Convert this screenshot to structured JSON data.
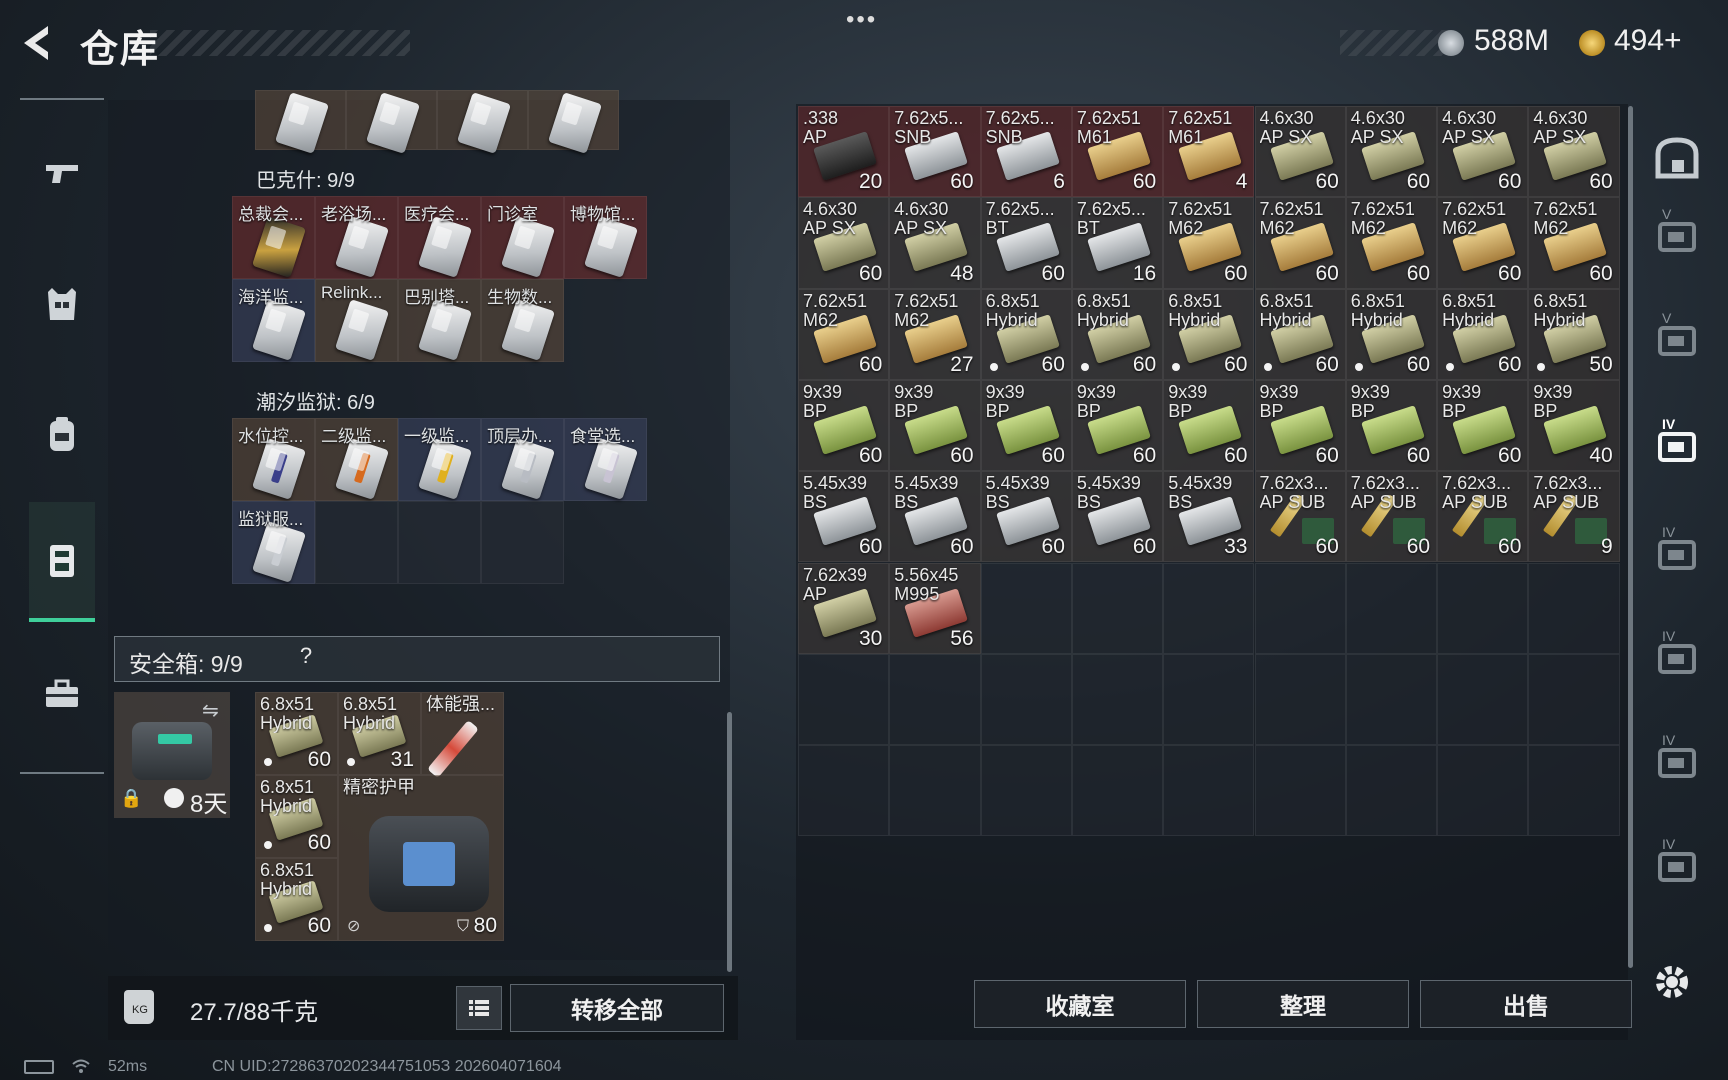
{
  "header": {
    "title": "仓库",
    "menu_dots": "•••",
    "currency_silver": "588M",
    "currency_gold": "494+",
    "gold_plus": "+"
  },
  "left_nav": {
    "items": [
      {
        "name": "weapons",
        "icon": "gun-icon"
      },
      {
        "name": "armor",
        "icon": "vest-icon"
      },
      {
        "name": "backpack",
        "icon": "backpack-icon"
      },
      {
        "name": "containers",
        "icon": "container-icon",
        "active": true
      },
      {
        "name": "toolbox",
        "icon": "briefcase-icon"
      }
    ]
  },
  "keycards": {
    "top_row_count": 4,
    "bakshi": {
      "label": "巴克什: 9/9",
      "items": [
        {
          "name": "总裁会...",
          "color": "red",
          "style": "gold"
        },
        {
          "name": "老浴场...",
          "color": "red"
        },
        {
          "name": "医疗会...",
          "color": "red"
        },
        {
          "name": "门诊室",
          "color": "red"
        },
        {
          "name": "博物馆...",
          "color": "red"
        },
        {
          "name": "海洋监...",
          "color": "blue"
        },
        {
          "name": "Relink...",
          "color": "brown"
        },
        {
          "name": "巴别塔...",
          "color": "brown"
        },
        {
          "name": "生物数...",
          "color": "brown"
        }
      ]
    },
    "tide_prison": {
      "label": "潮汐监狱: 6/9",
      "items": [
        {
          "name": "水位控...",
          "color": "brown",
          "stripe": "#3a3f8a"
        },
        {
          "name": "二级监...",
          "color": "brown",
          "stripe": "#d66a1e"
        },
        {
          "name": "一级监...",
          "color": "blue",
          "stripe": "#e0b01e"
        },
        {
          "name": "顶层办...",
          "color": "blue",
          "stripe": "#b8bcc3"
        },
        {
          "name": "食堂选...",
          "color": "blue",
          "stripe": "#c8c3d3"
        },
        {
          "name": "监狱服...",
          "color": "blue",
          "stripe": "#c9cdd2"
        }
      ]
    }
  },
  "safebox": {
    "title": "安全箱:  9/9",
    "help": "?",
    "timer": "8天",
    "items": [
      {
        "name": "6.8x51 Hybrid",
        "line1": "6.8x51",
        "line2": "Hybrid",
        "count": "60",
        "dot": true
      },
      {
        "name": "6.8x51 Hybrid",
        "line1": "6.8x51",
        "line2": "Hybrid",
        "count": "31",
        "dot": true
      },
      {
        "name": "体能强...",
        "line1": "体能强...",
        "line2": "",
        "count": "",
        "dot": false
      },
      {
        "name": "6.8x51 Hybrid",
        "line1": "6.8x51",
        "line2": "Hybrid",
        "count": "60",
        "dot": true
      },
      {
        "name": "6.8x51 Hybrid",
        "line1": "6.8x51",
        "line2": "Hybrid",
        "count": "60",
        "dot": true
      }
    ],
    "armor": {
      "name": "精密护甲",
      "durability": "80"
    }
  },
  "weight": {
    "icon_text": "KG",
    "value": "27.7/88千克",
    "transfer_all": "转移全部"
  },
  "stash": {
    "rows": [
      [
        {
          "l1": ".338",
          "l2": "AP",
          "count": "20",
          "type": "black",
          "red": true
        },
        {
          "l1": "7.62x5...",
          "l2": "SNB",
          "count": "60",
          "type": "grey",
          "red": true
        },
        {
          "l1": "7.62x5...",
          "l2": "SNB",
          "count": "6",
          "type": "grey",
          "red": true
        },
        {
          "l1": "7.62x51",
          "l2": "M61",
          "count": "60",
          "type": "tan",
          "red": true
        },
        {
          "l1": "7.62x51",
          "l2": "M61",
          "count": "4",
          "type": "tan",
          "red": true
        },
        {
          "l1": "4.6x30",
          "l2": "AP SX",
          "count": "60",
          "type": "olive"
        },
        {
          "l1": "4.6x30",
          "l2": "AP SX",
          "count": "60",
          "type": "olive"
        },
        {
          "l1": "4.6x30",
          "l2": "AP SX",
          "count": "60",
          "type": "olive"
        },
        {
          "l1": "4.6x30",
          "l2": "AP SX",
          "count": "60",
          "type": "olive"
        }
      ],
      [
        {
          "l1": "4.6x30",
          "l2": "AP SX",
          "count": "60",
          "type": "olive"
        },
        {
          "l1": "4.6x30",
          "l2": "AP SX",
          "count": "48",
          "type": "olive"
        },
        {
          "l1": "7.62x5...",
          "l2": "BT",
          "count": "60",
          "type": "grey"
        },
        {
          "l1": "7.62x5...",
          "l2": "BT",
          "count": "16",
          "type": "grey"
        },
        {
          "l1": "7.62x51",
          "l2": "M62",
          "count": "60",
          "type": "tan"
        },
        {
          "l1": "7.62x51",
          "l2": "M62",
          "count": "60",
          "type": "tan"
        },
        {
          "l1": "7.62x51",
          "l2": "M62",
          "count": "60",
          "type": "tan"
        },
        {
          "l1": "7.62x51",
          "l2": "M62",
          "count": "60",
          "type": "tan"
        },
        {
          "l1": "7.62x51",
          "l2": "M62",
          "count": "60",
          "type": "tan"
        }
      ],
      [
        {
          "l1": "7.62x51",
          "l2": "M62",
          "count": "60",
          "type": "tan"
        },
        {
          "l1": "7.62x51",
          "l2": "M62",
          "count": "27",
          "type": "tan"
        },
        {
          "l1": "6.8x51",
          "l2": "Hybrid",
          "count": "60",
          "type": "olive",
          "dot": true
        },
        {
          "l1": "6.8x51",
          "l2": "Hybrid",
          "count": "60",
          "type": "olive",
          "dot": true
        },
        {
          "l1": "6.8x51",
          "l2": "Hybrid",
          "count": "60",
          "type": "olive",
          "dot": true
        },
        {
          "l1": "6.8x51",
          "l2": "Hybrid",
          "count": "60",
          "type": "olive",
          "dot": true
        },
        {
          "l1": "6.8x51",
          "l2": "Hybrid",
          "count": "60",
          "type": "olive",
          "dot": true
        },
        {
          "l1": "6.8x51",
          "l2": "Hybrid",
          "count": "60",
          "type": "olive",
          "dot": true
        },
        {
          "l1": "6.8x51",
          "l2": "Hybrid",
          "count": "50",
          "type": "olive",
          "dot": true
        }
      ],
      [
        {
          "l1": "9x39",
          "l2": "BP",
          "count": "60",
          "type": "green"
        },
        {
          "l1": "9x39",
          "l2": "BP",
          "count": "60",
          "type": "green"
        },
        {
          "l1": "9x39",
          "l2": "BP",
          "count": "60",
          "type": "green"
        },
        {
          "l1": "9x39",
          "l2": "BP",
          "count": "60",
          "type": "green"
        },
        {
          "l1": "9x39",
          "l2": "BP",
          "count": "60",
          "type": "green"
        },
        {
          "l1": "9x39",
          "l2": "BP",
          "count": "60",
          "type": "green"
        },
        {
          "l1": "9x39",
          "l2": "BP",
          "count": "60",
          "type": "green"
        },
        {
          "l1": "9x39",
          "l2": "BP",
          "count": "60",
          "type": "green"
        },
        {
          "l1": "9x39",
          "l2": "BP",
          "count": "40",
          "type": "green"
        }
      ],
      [
        {
          "l1": "5.45x39",
          "l2": "BS",
          "count": "60",
          "type": "grey"
        },
        {
          "l1": "5.45x39",
          "l2": "BS",
          "count": "60",
          "type": "grey"
        },
        {
          "l1": "5.45x39",
          "l2": "BS",
          "count": "60",
          "type": "grey"
        },
        {
          "l1": "5.45x39",
          "l2": "BS",
          "count": "60",
          "type": "grey"
        },
        {
          "l1": "5.45x39",
          "l2": "BS",
          "count": "33",
          "type": "grey"
        },
        {
          "l1": "7.62x3...",
          "l2": "AP SUB",
          "count": "60",
          "type": "bullet"
        },
        {
          "l1": "7.62x3...",
          "l2": "AP SUB",
          "count": "60",
          "type": "bullet"
        },
        {
          "l1": "7.62x3...",
          "l2": "AP SUB",
          "count": "60",
          "type": "bullet"
        },
        {
          "l1": "7.62x3...",
          "l2": "AP SUB",
          "count": "9",
          "type": "bullet"
        }
      ],
      [
        {
          "l1": "7.62x39",
          "l2": "AP",
          "count": "30",
          "type": "olive"
        },
        {
          "l1": "5.56x45",
          "l2": "M995",
          "count": "56",
          "type": "red"
        }
      ]
    ]
  },
  "stash_actions": {
    "collection": "收藏室",
    "sort": "整理",
    "sell": "出售"
  },
  "right_nav": {
    "items": [
      {
        "label": "",
        "icon": "vault-icon"
      },
      {
        "label": "V",
        "icon": "stash-5-icon"
      },
      {
        "label": "V",
        "icon": "stash-5b-icon"
      },
      {
        "label": "IV",
        "icon": "stash-4-icon",
        "active": true
      },
      {
        "label": "IV",
        "icon": "stash-4b-icon"
      },
      {
        "label": "IV",
        "icon": "stash-4c-icon"
      },
      {
        "label": "IV",
        "icon": "stash-4d-icon"
      },
      {
        "label": "IV",
        "icon": "stash-4e-icon"
      }
    ]
  },
  "footer": {
    "ping": "52ms",
    "uid": "CN UID:2728637020234475105З 202604071604"
  },
  "colors": {
    "accent": "#3fcf9a",
    "red_slot": "#6e2a2c",
    "blue_slot": "#3a425f",
    "brown_slot": "#5c4a3a"
  }
}
